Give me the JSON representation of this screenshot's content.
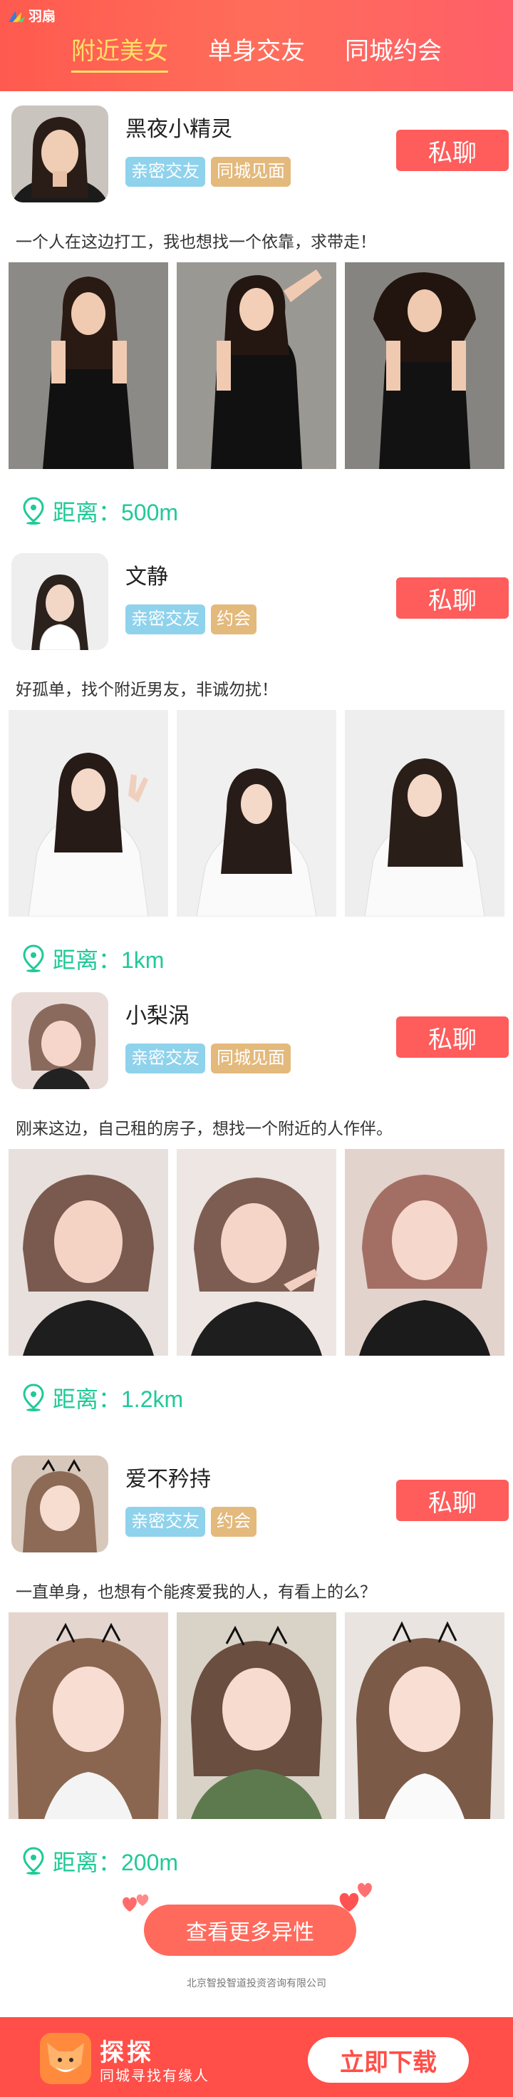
{
  "header": {
    "logo_text": "羽扇",
    "tabs": [
      {
        "label": "附近美女",
        "active": true
      },
      {
        "label": "单身交友",
        "active": false
      },
      {
        "label": "同城约会",
        "active": false
      }
    ]
  },
  "profiles": [
    {
      "name": "黑夜小精灵",
      "tags": [
        {
          "label": "亲密交友",
          "color": "blue"
        },
        {
          "label": "同城见面",
          "color": "gold"
        }
      ],
      "chat_label": "私聊",
      "bio": "一个人在这边打工，我也想找一个依靠，求带走！",
      "distance_label": "距离：500m"
    },
    {
      "name": "文静",
      "tags": [
        {
          "label": "亲密交友",
          "color": "blue"
        },
        {
          "label": "约会",
          "color": "gold"
        }
      ],
      "chat_label": "私聊",
      "bio": "好孤单，找个附近男友，非诚勿扰！",
      "distance_label": "距离：1km"
    },
    {
      "name": "小梨涡",
      "tags": [
        {
          "label": "亲密交友",
          "color": "blue"
        },
        {
          "label": "同城见面",
          "color": "gold"
        }
      ],
      "chat_label": "私聊",
      "bio": "刚来这边，自己租的房子，想找一个附近的人作伴。",
      "distance_label": "距离：1.2km"
    },
    {
      "name": "爱不矜持",
      "tags": [
        {
          "label": "亲密交友",
          "color": "blue"
        },
        {
          "label": "约会",
          "color": "gold"
        }
      ],
      "chat_label": "私聊",
      "bio": "一直单身，也想有个能疼爱我的人，有看上的么？",
      "distance_label": "距离：200m"
    }
  ],
  "more_button": "查看更多异性",
  "company": "北京智投智道投资咨询有限公司",
  "app_banner": {
    "name": "探探",
    "slogan": "同城寻找有缘人",
    "download_label": "立即下载"
  },
  "colors": {
    "header": "#ff5a4f",
    "chat_button": "#ff5c5c",
    "tag_blue": "#8fd2ec",
    "tag_gold": "#e3b97c",
    "distance_green": "#20c997",
    "bottom_bar": "#ff4f48"
  }
}
